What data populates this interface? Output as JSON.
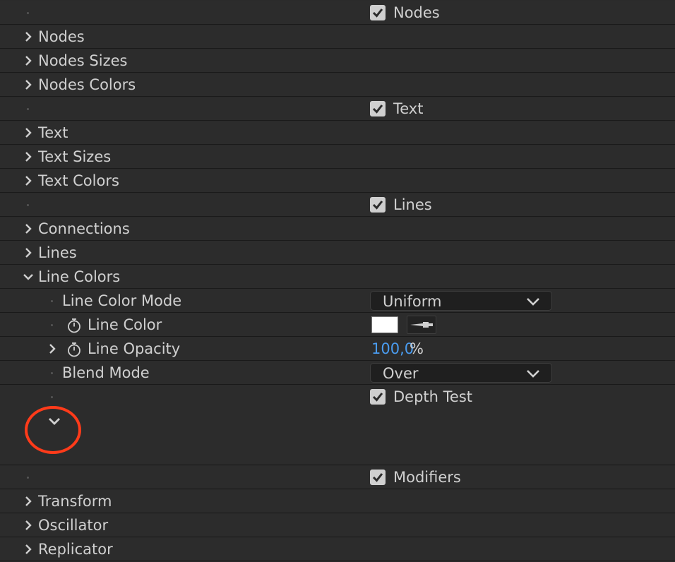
{
  "sections": [
    {
      "type": "checkbox-row",
      "label": "Nodes",
      "checked": true
    },
    {
      "type": "group",
      "label": "Nodes",
      "expanded": false
    },
    {
      "type": "group",
      "label": "Nodes Sizes",
      "expanded": false
    },
    {
      "type": "group",
      "label": "Nodes Colors",
      "expanded": false
    },
    {
      "type": "checkbox-row",
      "label": "Text",
      "checked": true
    },
    {
      "type": "group",
      "label": "Text",
      "expanded": false
    },
    {
      "type": "group",
      "label": "Text Sizes",
      "expanded": false
    },
    {
      "type": "group",
      "label": "Text Colors",
      "expanded": false
    },
    {
      "type": "checkbox-row",
      "label": "Lines",
      "checked": true
    },
    {
      "type": "group",
      "label": "Connections",
      "expanded": false
    },
    {
      "type": "group",
      "label": "Lines",
      "expanded": false
    },
    {
      "type": "group",
      "label": "Line Colors",
      "expanded": true
    }
  ],
  "line_colors": {
    "line_color_mode": {
      "label": "Line Color Mode",
      "value": "Uniform"
    },
    "line_color": {
      "label": "Line Color",
      "value": "#ffffff"
    },
    "line_opacity": {
      "label": "Line Opacity",
      "value": "100,0",
      "unit": "%"
    },
    "blend_mode": {
      "label": "Blend Mode",
      "value": "Over"
    },
    "depth_test": {
      "label": "Depth Test",
      "checked": true
    }
  },
  "modifiers": {
    "label": "Modifiers",
    "checked": true
  },
  "modifier_groups": [
    "Transform",
    "Oscillator",
    "Replicator"
  ],
  "colors": {
    "background": "#2c2c2c",
    "highlight_circle": "#ff3b1a",
    "value_blue": "#4a9cf0"
  }
}
